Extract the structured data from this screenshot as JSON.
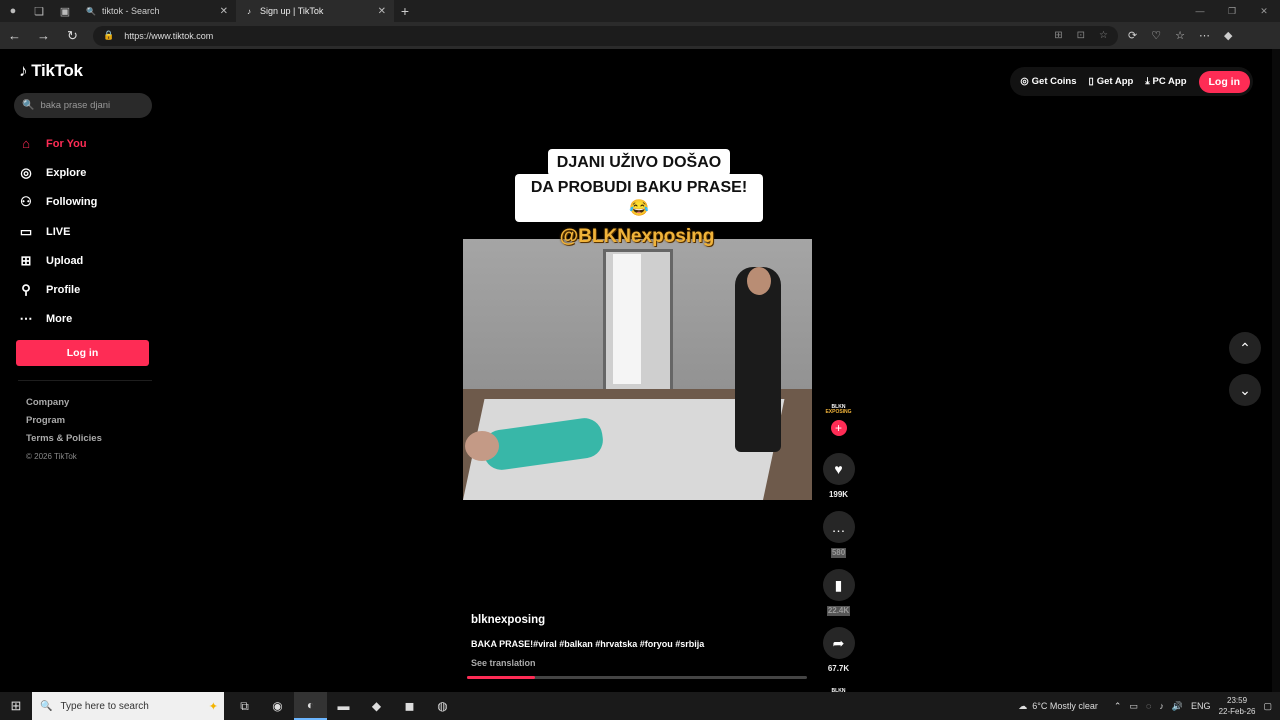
{
  "browser": {
    "tabs": [
      {
        "label": "tiktok - Search",
        "active": false
      },
      {
        "label": "Sign up | TikTok",
        "active": true
      }
    ],
    "url": "https://www.tiktok.com"
  },
  "sidebar": {
    "logo": "TikTok",
    "search_placeholder": "baka prase djani",
    "nav": [
      {
        "label": "For You",
        "icon": "home-icon"
      },
      {
        "label": "Explore",
        "icon": "compass-icon"
      },
      {
        "label": "Following",
        "icon": "following-icon"
      },
      {
        "label": "LIVE",
        "icon": "live-icon"
      },
      {
        "label": "Upload",
        "icon": "upload-icon"
      },
      {
        "label": "Profile",
        "icon": "profile-icon"
      },
      {
        "label": "More",
        "icon": "more-icon"
      }
    ],
    "login": "Log in",
    "footer": [
      "Company",
      "Program",
      "Terms & Policies"
    ],
    "copyright": "© 2026 TikTok"
  },
  "header": {
    "get_coins": "Get Coins",
    "get_app": "Get App",
    "pc_app": "PC App",
    "login": "Log in"
  },
  "video": {
    "caption_line1": "DJANI UŽIVO DOŠAO",
    "caption_line2": "DA PROBUDI BAKU PRASE!😂",
    "overlay_handle": "@BLKNexposing",
    "author": "blknexposing",
    "description": "BAKA PRASE!#viral #balkan #hrvatska #foryou #srbija",
    "see_translation": "See translation",
    "avatar_text_1": "BLKN",
    "avatar_text_2": "EXPOSING",
    "likes": "199K",
    "comments": "580",
    "saves": "22.4K",
    "shares": "67.7K",
    "progress": 0.2
  },
  "taskbar": {
    "search_placeholder": "Type here to search",
    "weather": "6°C  Mostly clear",
    "lang": "ENG",
    "time": "23:59",
    "date": "22-Feb-26"
  }
}
